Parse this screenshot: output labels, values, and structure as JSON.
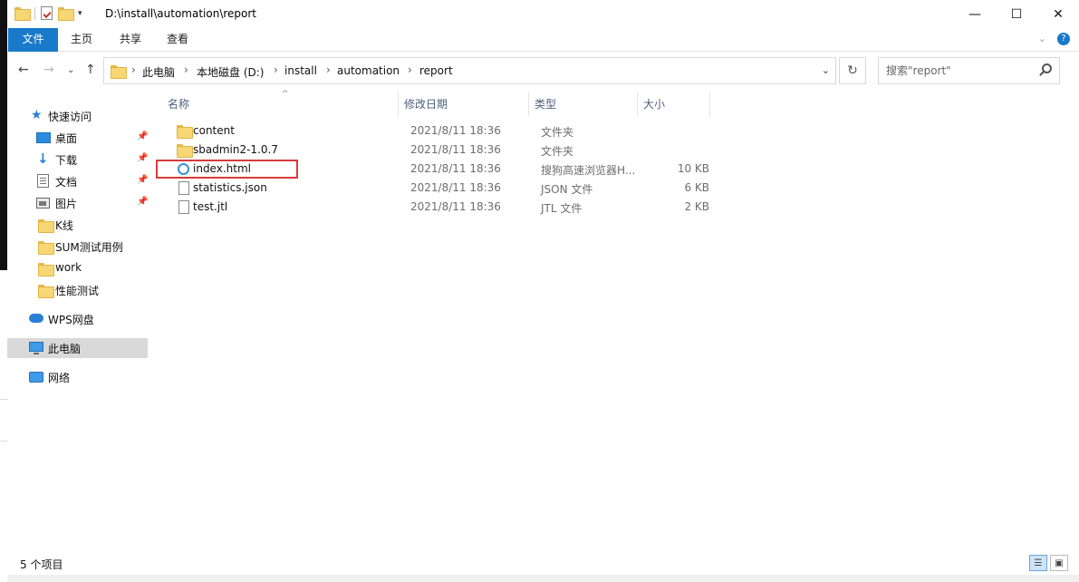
{
  "titlebar": {
    "path": "D:\\install\\automation\\report",
    "minimize_glyph": "—",
    "maximize_glyph": "☐",
    "close_glyph": "✕"
  },
  "ribbon": {
    "tabs": [
      {
        "label": "文件"
      },
      {
        "label": "主页"
      },
      {
        "label": "共享"
      },
      {
        "label": "查看"
      }
    ],
    "expand_glyph": "⌄",
    "help_glyph": "?"
  },
  "nav": {
    "back_glyph": "←",
    "forward_glyph": "→",
    "recent_glyph": "⌄",
    "up_glyph": "↑",
    "refresh_glyph": "↻",
    "dropdown_glyph": "⌄"
  },
  "address": {
    "sep": "›",
    "crumbs": [
      "此电脑",
      "本地磁盘 (D:)",
      "install",
      "automation",
      "report"
    ]
  },
  "search": {
    "placeholder": "搜索\"report\""
  },
  "navpane": {
    "pin_glyph": "📌",
    "items": [
      {
        "label": "快速访问",
        "icon": "star-icon"
      },
      {
        "label": "桌面",
        "icon": "desktop-icon",
        "pinned": true
      },
      {
        "label": "下载",
        "icon": "download-icon",
        "pinned": true
      },
      {
        "label": "文档",
        "icon": "documents-icon",
        "pinned": true
      },
      {
        "label": "图片",
        "icon": "pictures-icon",
        "pinned": true
      },
      {
        "label": "K线",
        "icon": "folder-icon"
      },
      {
        "label": "SUM测试用例",
        "icon": "folder-icon"
      },
      {
        "label": "work",
        "icon": "folder-icon"
      },
      {
        "label": "性能测试",
        "icon": "folder-icon"
      },
      {
        "label": "WPS网盘",
        "icon": "cloud-icon"
      },
      {
        "label": "此电脑",
        "icon": "computer-icon",
        "selected": true
      },
      {
        "label": "网络",
        "icon": "network-icon"
      }
    ]
  },
  "columns": {
    "name": "名称",
    "date": "修改日期",
    "type": "类型",
    "size": "大小",
    "sort_glyph": "^"
  },
  "files": [
    {
      "name": "content",
      "date": "2021/8/11 18:36",
      "type": "文件夹",
      "size": "",
      "icon": "folder-icon"
    },
    {
      "name": "sbadmin2-1.0.7",
      "date": "2021/8/11 18:36",
      "type": "文件夹",
      "size": "",
      "icon": "folder-icon"
    },
    {
      "name": "index.html",
      "date": "2021/8/11 18:36",
      "type": "搜狗高速浏览器H...",
      "size": "10 KB",
      "icon": "html-file-icon"
    },
    {
      "name": "statistics.json",
      "date": "2021/8/11 18:36",
      "type": "JSON 文件",
      "size": "6 KB",
      "icon": "file-icon"
    },
    {
      "name": "test.jtl",
      "date": "2021/8/11 18:36",
      "type": "JTL 文件",
      "size": "2 KB",
      "icon": "file-icon"
    }
  ],
  "statusbar": {
    "count": "5 个项目",
    "details_glyph": "☰",
    "tiles_glyph": "▣"
  },
  "colors": {
    "accent": "#1979ca",
    "highlight": "#d83b3b",
    "selected_nav": "#d9d9d9"
  }
}
